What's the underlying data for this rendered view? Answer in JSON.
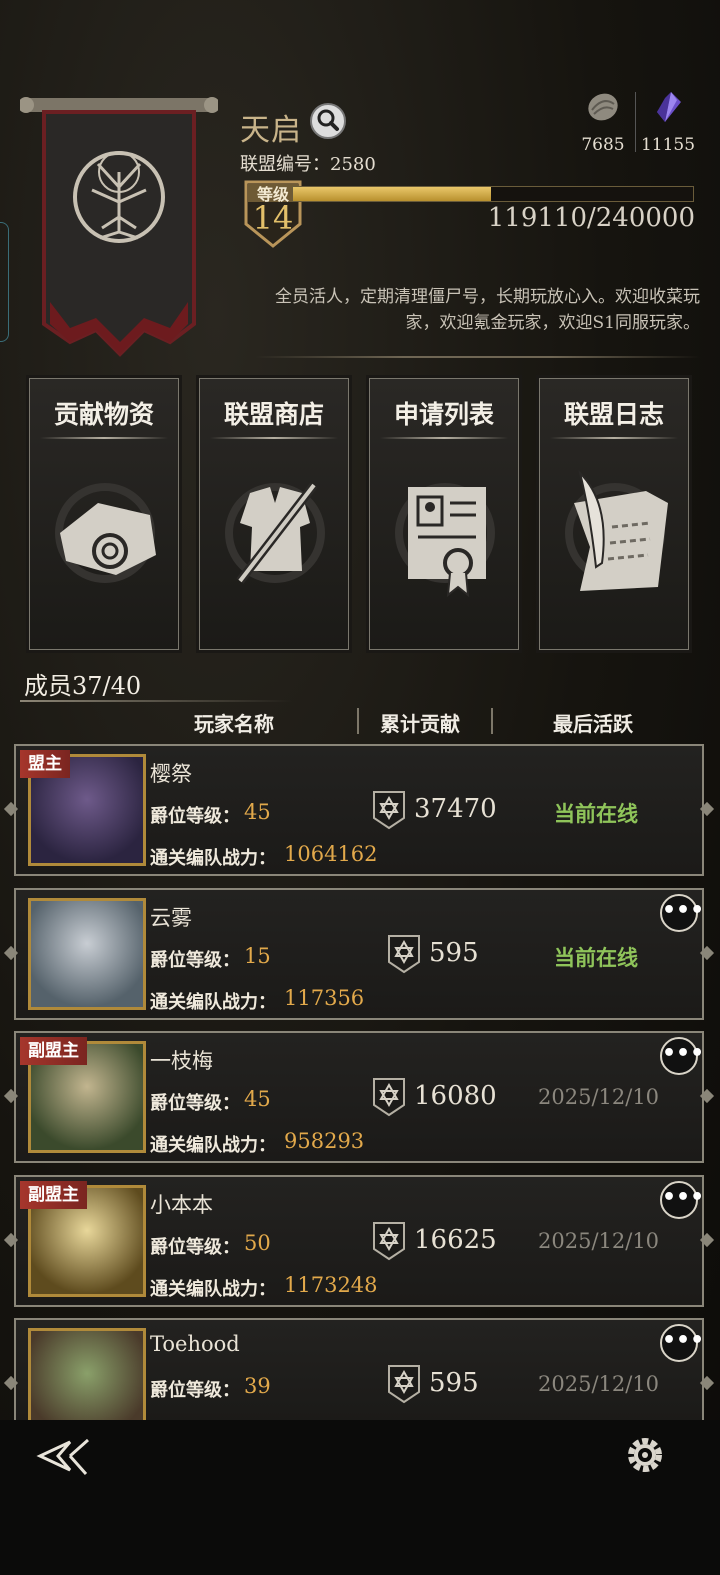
{
  "header": {
    "alliance_name": "天启",
    "alliance_id_label": "联盟编号：",
    "alliance_id": "2580",
    "level_label": "等级",
    "level": "14",
    "xp_text": "119110/240000",
    "xp_fraction": 0.496,
    "announcement": "全员活人，定期清理僵尸号，长期玩放心入。欢迎收菜玩家，欢迎氪金玩家，欢迎S1同服玩家。",
    "currencies": [
      {
        "icon": "stone-coin-icon",
        "value": "7685"
      },
      {
        "icon": "purple-crystal-icon",
        "value": "11155"
      }
    ]
  },
  "features": [
    {
      "label": "贡献物资",
      "icon": "scroll-bundle-icon"
    },
    {
      "label": "联盟商店",
      "icon": "armor-sword-icon"
    },
    {
      "label": "申请列表",
      "icon": "certificate-icon"
    },
    {
      "label": "联盟日志",
      "icon": "quill-paper-icon"
    }
  ],
  "members_section": {
    "count_label": "成员37/40",
    "columns": {
      "name": "玩家名称",
      "contribution": "累计贡献",
      "last_active": "最后活跃"
    },
    "rank_label": "爵位等级：",
    "power_label": "通关编队战力："
  },
  "members": [
    {
      "role": "盟主",
      "name": "樱祭",
      "rank": "45",
      "power": "1064162",
      "contribution": "37470",
      "status": "当前在线",
      "online": true
    },
    {
      "role": "",
      "name": "云雾",
      "rank": "15",
      "power": "117356",
      "contribution": "595",
      "status": "当前在线",
      "online": true
    },
    {
      "role": "副盟主",
      "name": "一枝梅",
      "rank": "45",
      "power": "958293",
      "contribution": "16080",
      "status": "2025/12/10",
      "online": false
    },
    {
      "role": "副盟主",
      "name": "小本本",
      "rank": "50",
      "power": "1173248",
      "contribution": "16625",
      "status": "2025/12/10",
      "online": false
    },
    {
      "role": "",
      "name": "Toehood",
      "rank": "39",
      "power": "",
      "contribution": "595",
      "status": "2025/12/10",
      "online": false
    }
  ],
  "colors": {
    "gold": "#e2a94b",
    "online_green": "#8fc45a",
    "role_red": "#a6362c"
  },
  "bottom_bar": {
    "back_icon": "back-arrow-icon",
    "settings_icon": "gear-icon"
  }
}
